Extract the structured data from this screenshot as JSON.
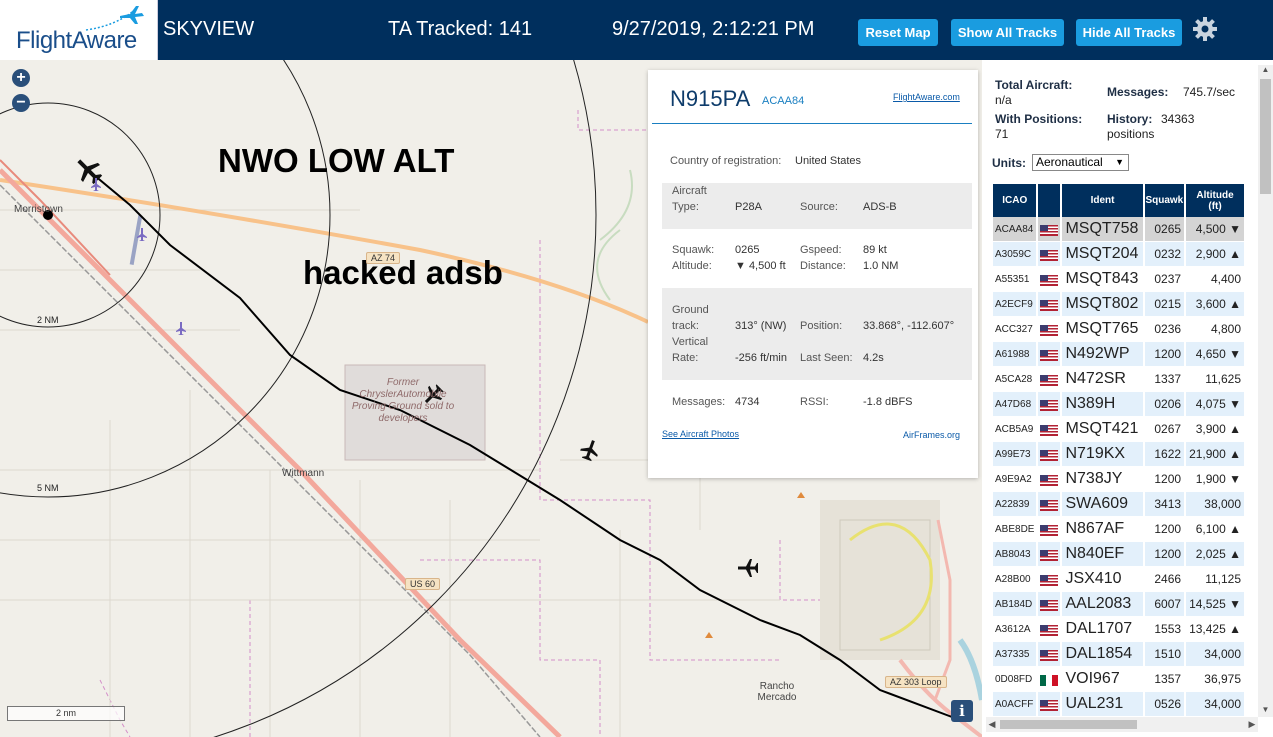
{
  "header": {
    "logo": "FlightAware",
    "title": "SKYVIEW",
    "tracked": "TA Tracked: 141",
    "datetime": "9/27/2019, 2:12:21 PM",
    "buttons": {
      "reset": "Reset Map",
      "show": "Show All Tracks",
      "hide": "Hide All Tracks"
    },
    "settings_icon": "gear-icon",
    "accent_color": "#1a9ce0",
    "bar_color": "#002f5d"
  },
  "map": {
    "zoom_in": "+",
    "zoom_out": "−",
    "overlay_text_1": "NWO LOW ALT",
    "overlay_text_2": "hacked adsb",
    "places": {
      "morristown": "Morristown",
      "wittmann": "Wittmann",
      "rancho": "Rancho\nMercado"
    },
    "proving_ground": "Former ChryslerAutomobile Proving Ground sold to developers",
    "range_rings": {
      "inner": "2 NM",
      "outer": "5 NM"
    },
    "roads": {
      "az74": "AZ 74",
      "us60": "US 60",
      "az303": "AZ 303 Loop"
    },
    "scale": "2 nm",
    "info": "i"
  },
  "detail": {
    "registration": "N915PA",
    "icao": "ACAA84",
    "fa_link": "FlightAware.com",
    "country_label": "Country of registration:",
    "country": "United States",
    "aircraft_type_label": "Aircraft",
    "aircraft_type_label2": "Type:",
    "aircraft_type": "P28A",
    "source_label": "Source:",
    "source": "ADS-B",
    "squawk_label": "Squawk:",
    "squawk": "0265",
    "gspeed_label": "Gspeed:",
    "gspeed": "89 kt",
    "altitude_label": "Altitude:",
    "altitude": "▼ 4,500 ft",
    "distance_label": "Distance:",
    "distance": "1.0 NM",
    "track_label1": "Ground",
    "track_label2": "track:",
    "track": "313° (NW)",
    "position_label": "Position:",
    "position": "33.868°, -112.607°",
    "vrate_label1": "Vertical",
    "vrate_label2": "Rate:",
    "vrate": "-256 ft/min",
    "lastseen_label": "Last Seen:",
    "lastseen": "4.2s",
    "messages_label": "Messages:",
    "messages": "4734",
    "rssi_label": "RSSI:",
    "rssi": "-1.8 dBFS",
    "photos_link": "See Aircraft Photos",
    "airframes_link": "AirFrames.org"
  },
  "sidebar": {
    "total_label": "Total Aircraft:",
    "total_value": "n/a",
    "messages_label": "Messages:",
    "messages_value": "745.7/sec",
    "withpos_label": "With Positions:",
    "withpos_value": "71",
    "history_label": "History:",
    "history_value": "34363",
    "history_unit": "positions",
    "units_label": "Units:",
    "units_value": "Aeronautical",
    "columns": [
      "ICAO",
      "",
      "Ident",
      "Squawk",
      "Altitude\n(ft)"
    ],
    "rows": [
      {
        "icao": "ACAA84",
        "flag": "us",
        "ident": "MSQT758",
        "squawk": "0265",
        "alt": "4,500 ▼"
      },
      {
        "icao": "A3059C",
        "flag": "us",
        "ident": "MSQT204",
        "squawk": "0232",
        "alt": "2,900 ▲"
      },
      {
        "icao": "A55351",
        "flag": "us",
        "ident": "MSQT843",
        "squawk": "0237",
        "alt": "4,400"
      },
      {
        "icao": "A2ECF9",
        "flag": "us",
        "ident": "MSQT802",
        "squawk": "0215",
        "alt": "3,600 ▲"
      },
      {
        "icao": "ACC327",
        "flag": "us",
        "ident": "MSQT765",
        "squawk": "0236",
        "alt": "4,800"
      },
      {
        "icao": "A61988",
        "flag": "us",
        "ident": "N492WP",
        "squawk": "1200",
        "alt": "4,650 ▼"
      },
      {
        "icao": "A5CA28",
        "flag": "us",
        "ident": "N472SR",
        "squawk": "1337",
        "alt": "11,625"
      },
      {
        "icao": "A47D68",
        "flag": "us",
        "ident": "N389H",
        "squawk": "0206",
        "alt": "4,075 ▼"
      },
      {
        "icao": "ACB5A9",
        "flag": "us",
        "ident": "MSQT421",
        "squawk": "0267",
        "alt": "3,900 ▲"
      },
      {
        "icao": "A99E73",
        "flag": "us",
        "ident": "N719KX",
        "squawk": "1622",
        "alt": "21,900 ▲"
      },
      {
        "icao": "A9E9A2",
        "flag": "us",
        "ident": "N738JY",
        "squawk": "1200",
        "alt": "1,900 ▼"
      },
      {
        "icao": "A22839",
        "flag": "us",
        "ident": "SWA609",
        "squawk": "3413",
        "alt": "38,000"
      },
      {
        "icao": "ABE8DE",
        "flag": "us",
        "ident": "N867AF",
        "squawk": "1200",
        "alt": "6,100 ▲"
      },
      {
        "icao": "AB8043",
        "flag": "us",
        "ident": "N840EF",
        "squawk": "1200",
        "alt": "2,025 ▲"
      },
      {
        "icao": "A28B00",
        "flag": "us",
        "ident": "JSX410",
        "squawk": "2466",
        "alt": "11,125"
      },
      {
        "icao": "AB184D",
        "flag": "us",
        "ident": "AAL2083",
        "squawk": "6007",
        "alt": "14,525 ▼"
      },
      {
        "icao": "A3612A",
        "flag": "us",
        "ident": "DAL1707",
        "squawk": "1553",
        "alt": "13,425 ▲"
      },
      {
        "icao": "A37335",
        "flag": "us",
        "ident": "DAL1854",
        "squawk": "1510",
        "alt": "34,000"
      },
      {
        "icao": "0D08FD",
        "flag": "mx",
        "ident": "VOI967",
        "squawk": "1357",
        "alt": "36,975"
      },
      {
        "icao": "A0ACFF",
        "flag": "us",
        "ident": "UAL231",
        "squawk": "0526",
        "alt": "34,000"
      }
    ]
  }
}
